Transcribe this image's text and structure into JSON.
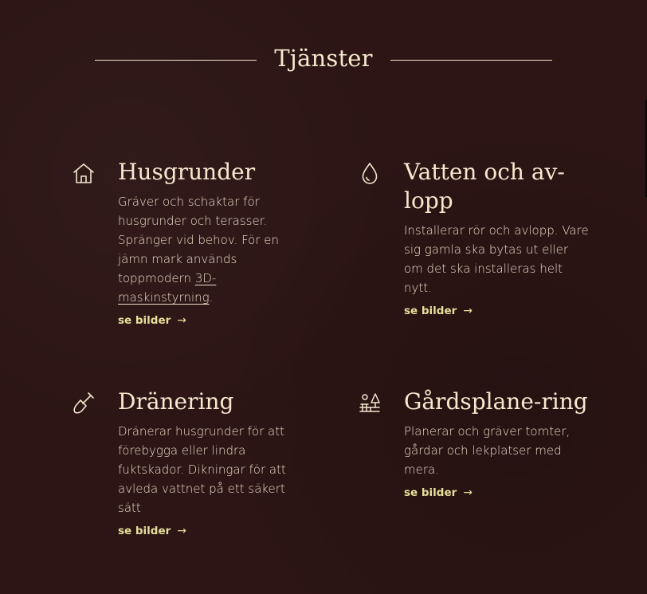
{
  "section": {
    "title": "Tjänster"
  },
  "colors": {
    "background": "#2c1514",
    "heading": "#f7e8cf",
    "body_text": "#e9dcc6",
    "link_accent": "#e7df9b"
  },
  "services": [
    {
      "icon": "house-icon",
      "title": "Husgrunder",
      "description_before_link": "Gräver och schaktar för husgrunder och terasser. Spränger vid behov. För en jämn mark används toppmodern ",
      "description_link": "3D-maskinstyrning",
      "description_after_link": ".",
      "link_label": "se bilder",
      "link_arrow": "→"
    },
    {
      "icon": "water-drop-icon",
      "title": "Vatten och av-lopp",
      "description": "Installerar rör och avlopp. Vare sig gamla ska bytas ut eller om det ska installeras helt nytt.",
      "link_label": "se bilder",
      "link_arrow": "→"
    },
    {
      "icon": "shovel-icon",
      "title": "Dränering",
      "description": "Dränerar husgrunder för att förebygga eller lindra fuktskador. Dikningar för att avleda vattnet på ett säkert sätt",
      "link_label": "se bilder",
      "link_arrow": "→"
    },
    {
      "icon": "yard-landscape-icon",
      "title": "Gårdsplane-ring",
      "description": "Planerar och gräver tomter, gårdar och lekplatser med mera.",
      "link_label": "se bilder",
      "link_arrow": "→"
    }
  ]
}
